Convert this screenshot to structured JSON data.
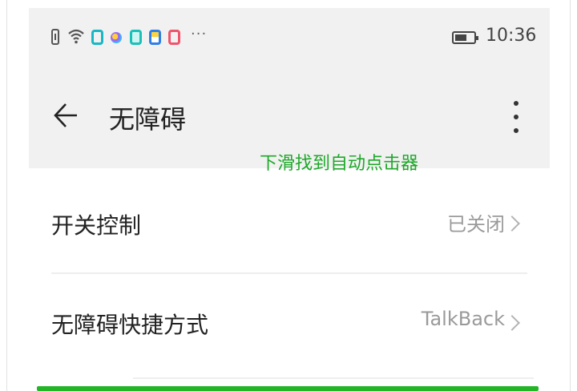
{
  "status_bar": {
    "time": "10:36",
    "overflow_indicator": "···",
    "icons": [
      "sim-icon",
      "wifi-icon",
      "app-notification-icon",
      "app-notification-icon",
      "app-notification-icon",
      "app-notification-icon",
      "app-notification-icon",
      "battery-icon"
    ]
  },
  "header": {
    "title": "无障碍",
    "back_icon": "arrow-left-icon",
    "more_icon": "more-vertical-icon"
  },
  "hint_text": "下滑找到自动点击器",
  "settings": {
    "items": [
      {
        "label": "开关控制",
        "value": "已关闭"
      },
      {
        "label": "无障碍快捷方式",
        "value": "TalkBack"
      }
    ]
  },
  "colors": {
    "header_bg": "#f1f1f1",
    "hint_green": "#1ea82a",
    "highlight_green": "#22b526"
  }
}
